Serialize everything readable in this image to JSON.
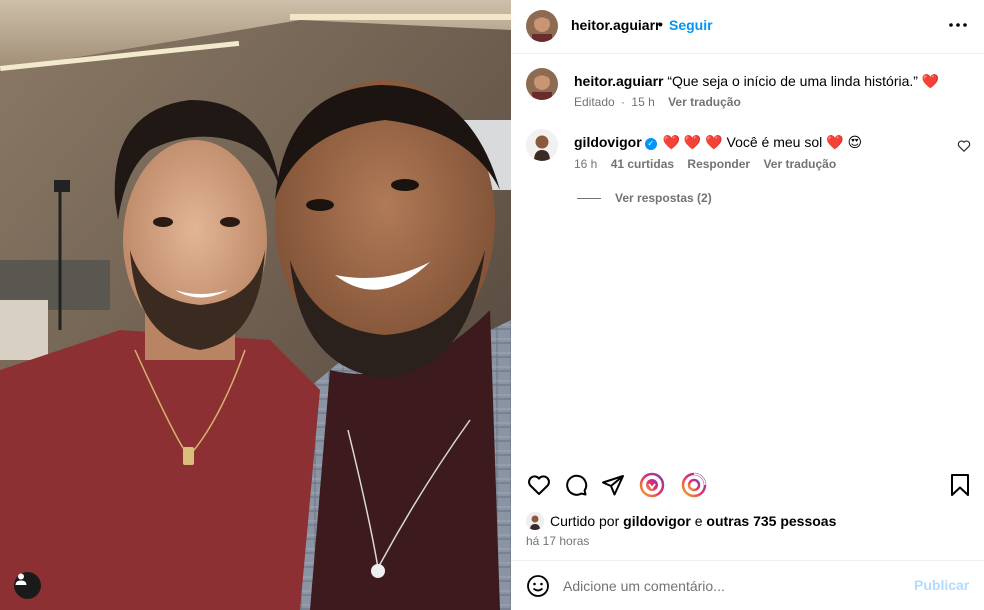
{
  "post_author": {
    "username": "heitor.aguiarr",
    "separator": "•",
    "follow_label": "Seguir"
  },
  "caption": {
    "username": "heitor.aguiarr",
    "text": "“Que seja o início de uma linda história.”",
    "emoji": "❤️",
    "edited": "Editado",
    "dot": "·",
    "age": "15 h",
    "translate": "Ver tradução"
  },
  "comment": {
    "username": "gildovigor",
    "hearts": "❤️ ❤️ ❤️",
    "text": "Você é meu sol",
    "emoji_heart": "❤️",
    "emoji_face": "😍",
    "age": "16 h",
    "likes": "41 curtidas",
    "reply": "Responder",
    "translate": "Ver tradução",
    "view_replies": "Ver respostas (2)"
  },
  "likes": {
    "prefix": "Curtido por",
    "user": "gildovigor",
    "conj": "e",
    "others": "outras 735 pessoas"
  },
  "post_time": "há 17 horas",
  "add_comment": {
    "placeholder": "Adicione um comentário...",
    "publish_label": "Publicar"
  },
  "icons": {
    "more": "more-options-icon",
    "like": "heart-icon",
    "comment": "comment-icon",
    "share": "share-icon",
    "save": "bookmark-icon",
    "emoji": "emoji-icon",
    "tag": "user-tag-icon"
  },
  "colors": {
    "link": "#0095f6",
    "muted": "#737373",
    "publish_disabled": "#b3dbff",
    "heart": "#ed1c3a"
  }
}
